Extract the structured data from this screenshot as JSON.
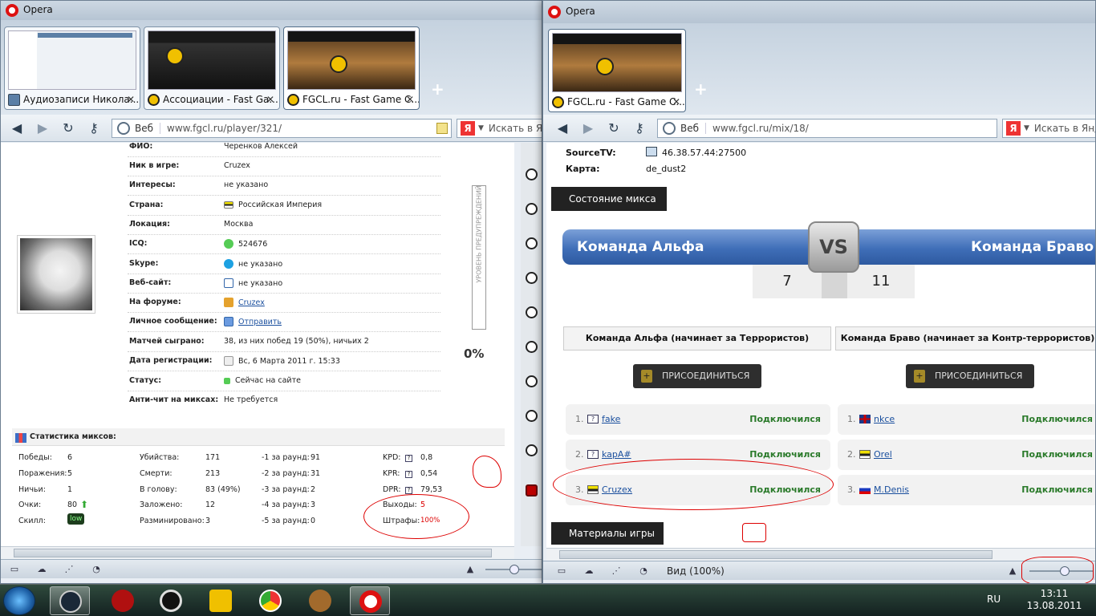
{
  "browser_left": {
    "app": "Opera",
    "tabs": [
      {
        "title": "Аудиозаписи Никола..."
      },
      {
        "title": "Ассоциации - Fast Ga..."
      },
      {
        "title": "FGCL.ru - Fast Game C..."
      }
    ],
    "address": {
      "mode": "Веб",
      "url": "www.fgcl.ru/player/321/"
    },
    "search_placeholder": "Искать в Янд"
  },
  "profile": {
    "rows": [
      {
        "k": "ФИО:",
        "v": "Черенков Алексей"
      },
      {
        "k": "Ник в игре:",
        "v": "Cruzex"
      },
      {
        "k": "Интересы:",
        "v": "не указано"
      },
      {
        "k": "Страна:",
        "v": "Российская Империя"
      },
      {
        "k": "Локация:",
        "v": "Москва"
      },
      {
        "k": "ICQ:",
        "v": "524676"
      },
      {
        "k": "Skype:",
        "v": "не указано"
      },
      {
        "k": "Веб-сайт:",
        "v": "не указано"
      },
      {
        "k": "На форуме:",
        "v": "Cruzex"
      },
      {
        "k": "Личное сообщение:",
        "v": "Отправить"
      },
      {
        "k": "Матчей сыграно:",
        "v": "38, из них побед 19 (50%), ничьих 2"
      },
      {
        "k": "Дата регистрации:",
        "v": "Вс, 6 Марта 2011 г. 15:33"
      },
      {
        "k": "Статус:",
        "v": "Сейчас на сайте"
      },
      {
        "k": "Анти-чит на миксах:",
        "v": "Не требуется"
      }
    ],
    "warning_label": "УРОВЕНЬ ПРЕДУПРЕЖДЕНИЙ",
    "warning_level": "0%"
  },
  "stats": {
    "title": "Статистика миксов:",
    "col1": [
      {
        "k": "Победы:",
        "v": "6"
      },
      {
        "k": "Поражения:",
        "v": "5"
      },
      {
        "k": "Ничьи:",
        "v": "1"
      },
      {
        "k": "Очки:",
        "v": "80"
      },
      {
        "k": "Скилл:",
        "v": "low"
      }
    ],
    "col2": [
      {
        "k": "Убийства:",
        "v": "171"
      },
      {
        "k": "Смерти:",
        "v": "213"
      },
      {
        "k": "В голову:",
        "v": "83 (49%)"
      },
      {
        "k": "Заложено:",
        "v": "12"
      },
      {
        "k": "Разминировано:",
        "v": "3"
      }
    ],
    "col3": [
      {
        "k": "-1 за раунд:",
        "v": "91"
      },
      {
        "k": "-2 за раунд:",
        "v": "31"
      },
      {
        "k": "-3 за раунд:",
        "v": "2"
      },
      {
        "k": "-4 за раунд:",
        "v": "3"
      },
      {
        "k": "-5 за раунд:",
        "v": "0"
      }
    ],
    "col4": [
      {
        "k": "KPD:",
        "v": "0,8"
      },
      {
        "k": "KPR:",
        "v": "0,54"
      },
      {
        "k": "DPR:",
        "v": "79,53"
      },
      {
        "k": "Выходы:",
        "v": "5"
      },
      {
        "k": "Штрафы:",
        "v": "100%"
      }
    ]
  },
  "browser_right": {
    "app": "Opera",
    "tabs": [
      {
        "title": "FGCL.ru - Fast Game C..."
      }
    ],
    "address": {
      "mode": "Веб",
      "url": "www.fgcl.ru/mix/18/"
    },
    "search_placeholder": "Искать в Янде",
    "status_zoom": "Вид (100%)"
  },
  "mix": {
    "sourcetv_label": "SourceTV:",
    "sourcetv": "46.38.57.44:27500",
    "map_label": "Карта:",
    "map": "de_dust2",
    "state_title": "Состояние микса",
    "team_a": "Команда Альфа",
    "team_b": "Команда Браво",
    "vs": "VS",
    "score_a": "7",
    "score_b": "11",
    "team_a_header": "Команда Альфа (начинает за Террористов)",
    "team_b_header": "Команда Браво (начинает за Контр-террористов)",
    "join_label": "ПРИСОЕДИНИТЬСЯ",
    "players_a": [
      {
        "n": "1.",
        "name": "fake",
        "status": "Подключился"
      },
      {
        "n": "2.",
        "name": "kapA#",
        "status": "Подключился"
      },
      {
        "n": "3.",
        "name": "Cruzex",
        "status": "Подключился"
      }
    ],
    "players_b": [
      {
        "n": "1.",
        "name": "nkce",
        "status": "Подключился"
      },
      {
        "n": "2.",
        "name": "Orel",
        "status": "Подключился"
      },
      {
        "n": "3.",
        "name": "M.Denis",
        "status": "Подключился"
      }
    ],
    "materials_title": "Материалы игры"
  },
  "taskbar": {
    "lang": "RU",
    "time": "13:11",
    "date": "13.08.2011"
  }
}
